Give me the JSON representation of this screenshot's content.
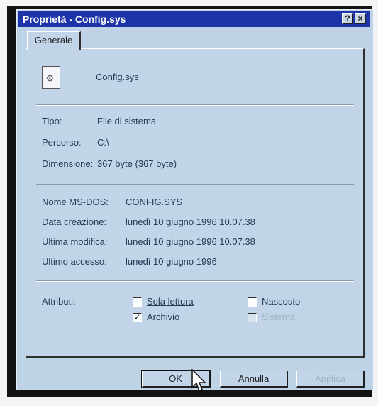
{
  "window": {
    "title": "Proprietà - Config.sys",
    "help_button": "?",
    "close_button": "×"
  },
  "tabs": [
    {
      "label": "Generale"
    }
  ],
  "file": {
    "name": "Config.sys",
    "icon": "system-file-gear-icon"
  },
  "info": {
    "type_label": "Tipo:",
    "type_value": "File di sistema",
    "path_label": "Percorso:",
    "path_value": "C:\\",
    "size_label": "Dimensione:",
    "size_value": "367 byte (367 byte)"
  },
  "details": {
    "msdos_label": "Nome MS-DOS:",
    "msdos_value": "CONFIG.SYS",
    "created_label": "Data creazione:",
    "created_value": "lunedì 10 giugno 1996 10.07.38",
    "modified_label": "Ultima modifica:",
    "modified_value": "lunedì 10 giugno 1996 10.07.38",
    "accessed_label": "Ultimo accesso:",
    "accessed_value": "lunedì 10 giugno 1996"
  },
  "attributes": {
    "label": "Attributi:",
    "read_only": {
      "label": "Sola lettura",
      "checked": false
    },
    "hidden": {
      "label": "Nascosto",
      "checked": false
    },
    "archive": {
      "label": "Archivio",
      "checked": true
    },
    "system": {
      "label": "Sistema",
      "checked": false,
      "disabled": true
    }
  },
  "buttons": {
    "ok": "OK",
    "cancel": "Annulla",
    "apply": "Applica"
  }
}
